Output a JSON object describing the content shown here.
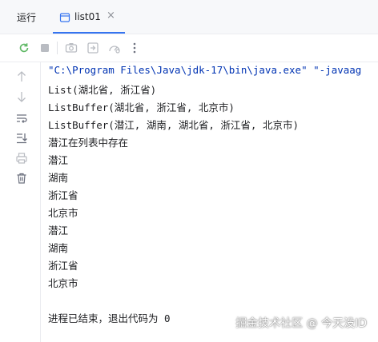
{
  "header": {
    "run_label": "运行",
    "tab_label": "list01",
    "tab_close": "×"
  },
  "toolbar": {
    "icons": [
      "rerun-icon",
      "stop-icon",
      "screenshot-icon",
      "restore-layout-icon",
      "settings-gauge-icon",
      "more-icon"
    ]
  },
  "console": {
    "command": "\"C:\\Program Files\\Java\\jdk-17\\bin\\java.exe\" \"-javaag",
    "lines": [
      "List(湖北省, 浙江省)",
      "ListBuffer(湖北省, 浙江省, 北京市)",
      "ListBuffer(潜江, 湖南, 湖北省, 浙江省, 北京市)",
      "潜江在列表中存在",
      "潜江",
      "湖南",
      "浙江省",
      "北京市",
      "潜江",
      "湖南",
      "浙江省",
      "北京市"
    ],
    "exit_message": "进程已结束，退出代码为 0"
  },
  "watermark": "掘金技术社区 @ 今天没ID",
  "colors": {
    "accent": "#3574f0",
    "command_text": "#0033b3",
    "toolbar_bg": "#f7f8fa",
    "rerun_green": "#5fb865"
  }
}
